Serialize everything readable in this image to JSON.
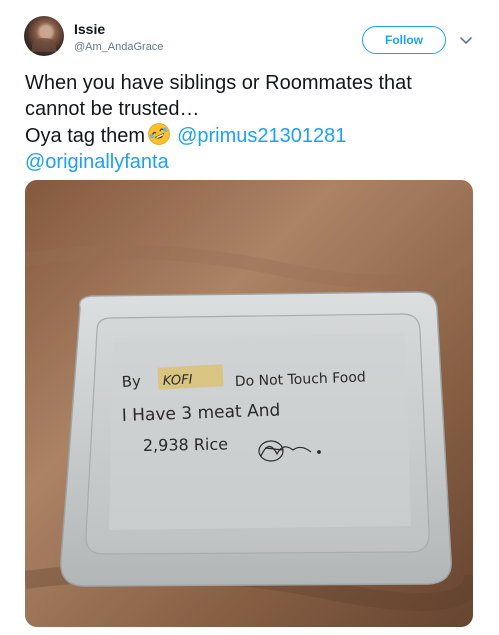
{
  "user": {
    "display_name": "Issie",
    "handle": "@Am_AndaGrace"
  },
  "follow_label": "Follow",
  "tweet": {
    "line1": "When you have siblings or Roommates that",
    "line2": "cannot be trusted…",
    "line3_prefix": "Oya tag them",
    "mention1": "@primus21301281",
    "mention2": "@originallyfanta",
    "emoji": "rolling-on-floor-laughing-icon"
  },
  "photo_note": {
    "line1_by": "By",
    "line1_name": "KOFI",
    "line1_rest": "Do Not  Touch Food",
    "line2": "I Have 3 meat And",
    "line3": "2,938 Rice"
  },
  "colors": {
    "link": "#1da1f2",
    "text": "#14171a",
    "secondary": "#657786"
  }
}
